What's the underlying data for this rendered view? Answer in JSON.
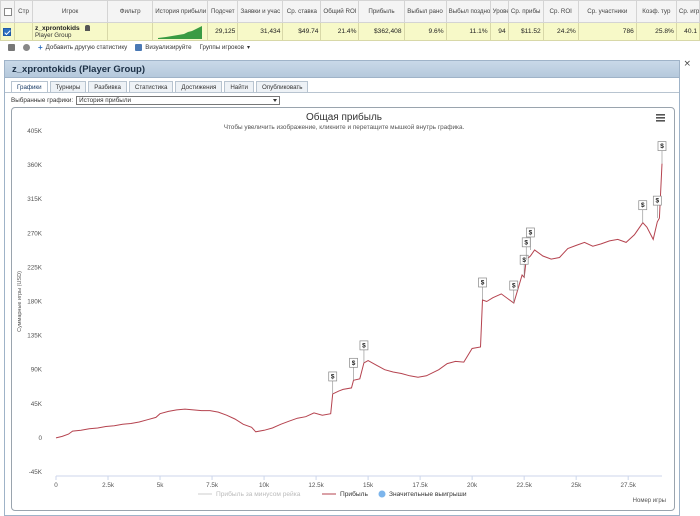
{
  "table": {
    "headers": [
      "Стр",
      "Игрок",
      "Фильтр",
      "История прибыли",
      "Подсчет",
      "Заявки и учас",
      "Ср. ставка",
      "Общий ROI",
      "Прибыль",
      "Выбыл рано",
      "Выбыл поздно",
      "Урове",
      "Ср. прибы",
      "Ср. ROI",
      "Ср. участники",
      "Коэф. тур",
      "Ср. игры /"
    ],
    "row": {
      "player": "z_xprontokids",
      "group": "Player Group",
      "filter": "",
      "count": "29,125",
      "entries": "31,434",
      "avg_stake": "$49.74",
      "total_roi": "21.4%",
      "profit": "$362,408",
      "early": "9.6%",
      "late": "11.1%",
      "level": "94",
      "avg_profit": "$11.52",
      "avg_roi": "24.2%",
      "avg_players": "786",
      "itm": "25.8%",
      "avg_games": "40.1"
    }
  },
  "toolbar": {
    "add_stat": "Добавить другую статистику",
    "visualize": "Визуализируйте",
    "groups": "Группы игроков"
  },
  "dialog": {
    "title": "z_xprontokids (Player Group)",
    "close": "×",
    "tabs": [
      "Графики",
      "Турниры",
      "Разбивка",
      "Статистика",
      "Достижения",
      "Найти",
      "Опубликовать"
    ],
    "select_label": "Выбранные графики:",
    "select_value": "История прибыли"
  },
  "colors": {
    "profit_line": "#b5434f",
    "milestone_marker": "#7cb5ec",
    "axis_label": "#555555",
    "header_bg": "#c9d9e8",
    "row_bg": "#f7f9c8"
  },
  "chart_data": {
    "type": "line",
    "title": "Общая прибыль",
    "subtitle": "Чтобы увеличить изображение, кликните и перетащите мышкой внутрь графика.",
    "xlabel": "Номер игры",
    "ylabel": "Суммарные игры (USD)",
    "xlim": [
      0,
      29125
    ],
    "ylim": [
      -45000,
      405000
    ],
    "xticks": [
      "0",
      "2.5k",
      "5k",
      "7.5k",
      "10k",
      "12.5k",
      "15k",
      "17.5k",
      "20k",
      "22.5k",
      "25k",
      "27.5k"
    ],
    "yticks": [
      "-45K",
      "0",
      "45K",
      "90K",
      "135K",
      "180K",
      "225K",
      "270K",
      "315K",
      "360K",
      "405K"
    ],
    "legend_placement": "bottom-center",
    "legend": [
      "Прибыль за минусом рейка",
      "Прибыль",
      "Значительные выигрыши"
    ],
    "series": [
      {
        "name": "Прибыль",
        "x": [
          0,
          300,
          600,
          800,
          1200,
          1600,
          2000,
          2400,
          2800,
          3200,
          3600,
          4000,
          4400,
          4800,
          5000,
          5400,
          5800,
          6200,
          6600,
          7000,
          7400,
          7800,
          8200,
          8600,
          9000,
          9400,
          9600,
          10000,
          10400,
          10800,
          11200,
          11600,
          12000,
          12400,
          12800,
          13200,
          13300,
          13600,
          13800,
          14200,
          14300,
          14600,
          14800,
          15000,
          15400,
          15800,
          16200,
          16600,
          17000,
          17400,
          17800,
          18400,
          18800,
          19200,
          19600,
          20000,
          20400,
          20500,
          20700,
          21000,
          21400,
          21800,
          22000,
          22400,
          22500,
          22600,
          22800,
          23000,
          23400,
          23800,
          24200,
          24600,
          25000,
          25400,
          25800,
          26200,
          26600,
          27000,
          27400,
          27800,
          28200,
          28400,
          28700,
          28900,
          29000,
          29125
        ],
        "y": [
          0,
          2000,
          5000,
          9000,
          10000,
          12000,
          13000,
          15000,
          16000,
          18000,
          19000,
          21000,
          24000,
          27000,
          32000,
          35000,
          37000,
          38000,
          37000,
          36000,
          36000,
          34000,
          30000,
          25000,
          18000,
          14000,
          8000,
          10000,
          13000,
          18000,
          22000,
          26000,
          28000,
          33000,
          30000,
          32000,
          58000,
          62000,
          64000,
          66000,
          76000,
          78000,
          99000,
          102000,
          96000,
          90000,
          87000,
          85000,
          82000,
          80000,
          82000,
          90000,
          98000,
          101000,
          100000,
          118000,
          120000,
          182000,
          180000,
          185000,
          190000,
          182000,
          178000,
          215000,
          212000,
          235000,
          240000,
          248000,
          240000,
          236000,
          238000,
          250000,
          254000,
          258000,
          253000,
          256000,
          260000,
          262000,
          258000,
          268000,
          284000,
          278000,
          262000,
          285000,
          290000,
          362000
        ]
      }
    ],
    "milestones": [
      {
        "x": 13300,
        "y": 58000
      },
      {
        "x": 14300,
        "y": 76000
      },
      {
        "x": 14800,
        "y": 99000
      },
      {
        "x": 20500,
        "y": 182000
      },
      {
        "x": 22000,
        "y": 178000
      },
      {
        "x": 22500,
        "y": 212000
      },
      {
        "x": 22600,
        "y": 235000
      },
      {
        "x": 22800,
        "y": 248000
      },
      {
        "x": 28200,
        "y": 284000
      },
      {
        "x": 28900,
        "y": 290000
      },
      {
        "x": 29125,
        "y": 362000
      }
    ],
    "milestone_symbol": "$",
    "grid": false
  }
}
